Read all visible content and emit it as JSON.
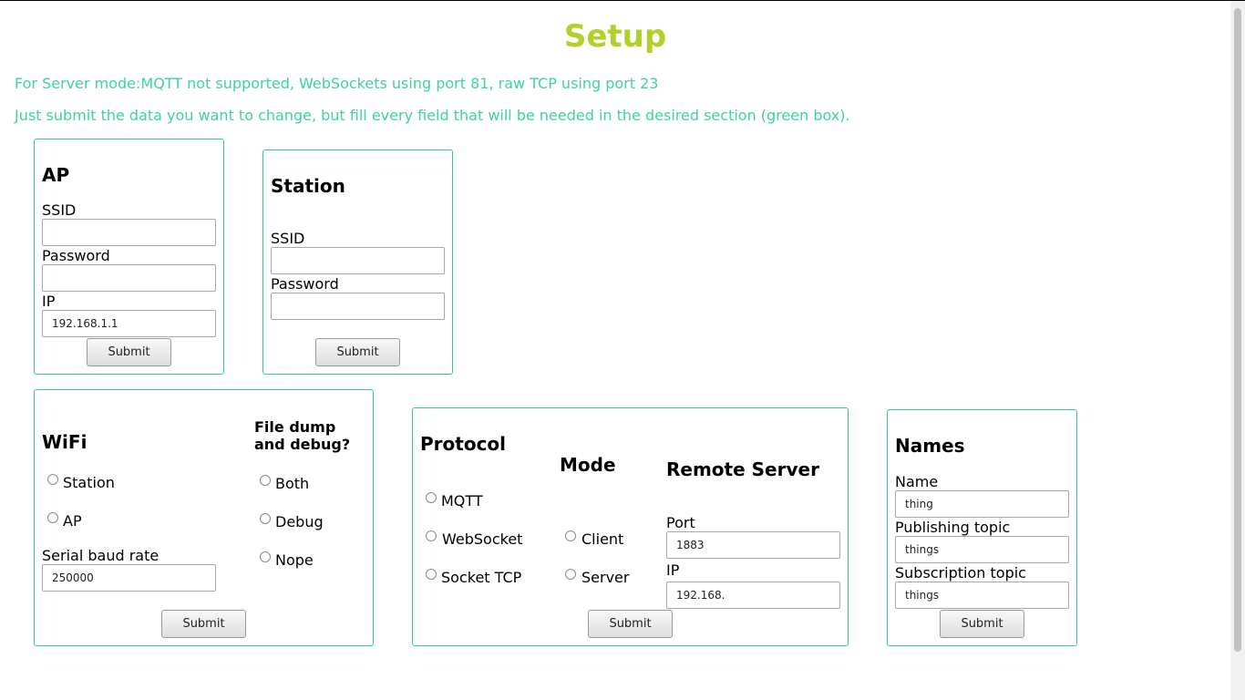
{
  "page": {
    "title": "Setup",
    "info_server_mode": "For Server mode:MQTT not supported, WebSockets using port 81, raw TCP using port 23",
    "info_submit": "Just submit the data you want to change, but fill every field that will be needed in the desired section (green box)."
  },
  "ap": {
    "heading": "AP",
    "ssid_label": "SSID",
    "ssid_value": "",
    "password_label": "Password",
    "password_value": "",
    "ip_label": "IP",
    "ip_value": "192.168.1.1",
    "submit": "Submit"
  },
  "station": {
    "heading": "Station",
    "ssid_label": "SSID",
    "ssid_value": "",
    "password_label": "Password",
    "password_value": "",
    "submit": "Submit"
  },
  "wifi": {
    "heading": "WiFi",
    "options": [
      "Station",
      "AP"
    ],
    "baud_label": "Serial baud rate",
    "baud_value": "250000",
    "dump_heading": "File dump and debug?",
    "dump_options": [
      "Both",
      "Debug",
      "Nope"
    ],
    "submit": "Submit"
  },
  "protocol": {
    "heading": "Protocol",
    "options": [
      "MQTT",
      "WebSocket",
      "Socket TCP"
    ],
    "mode_heading": "Mode",
    "mode_options": [
      "Client",
      "Server"
    ],
    "remote_heading": "Remote Server",
    "port_label": "Port",
    "port_value": "1883",
    "ip_label": "IP",
    "ip_value": "192.168.",
    "submit": "Submit"
  },
  "names": {
    "heading": "Names",
    "name_label": "Name",
    "name_value": "thing",
    "pub_label": "Publishing topic",
    "pub_value": "things",
    "sub_label": "Subscription topic",
    "sub_value": "things",
    "submit": "Submit"
  },
  "colors": {
    "title": "#b0d12a",
    "info_text": "#3ed49a",
    "box_border": "#2ecc8a"
  }
}
